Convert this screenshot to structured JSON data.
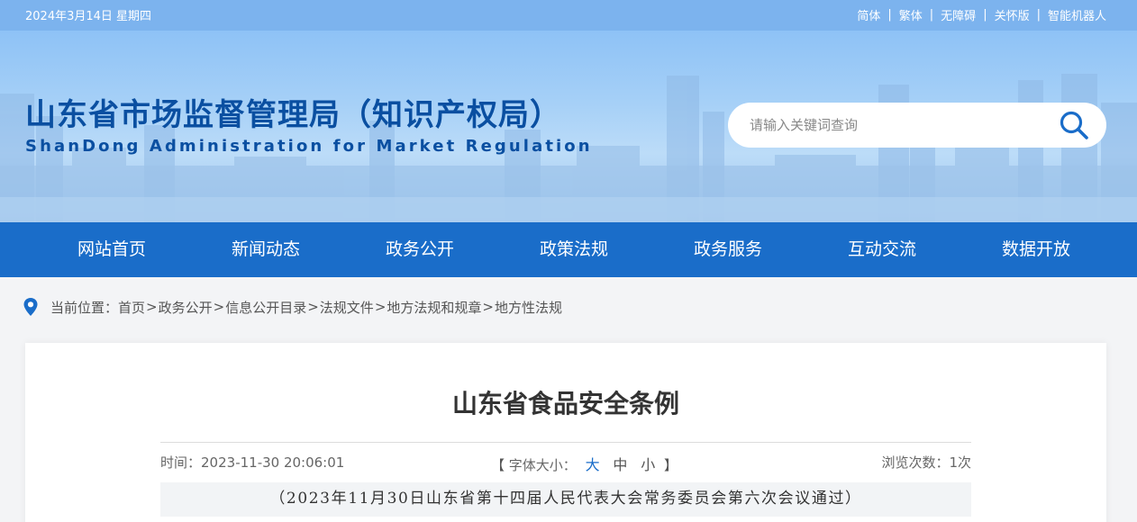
{
  "topbar": {
    "date": "2024年3月14日 星期四",
    "links": [
      "简体",
      "繁体",
      "无障碍",
      "关怀版",
      "智能机器人"
    ]
  },
  "header": {
    "title_cn": "山东省市场监督管理局（知识产权局）",
    "title_en": "ShanDong Administration for Market Regulation",
    "search_placeholder": "请输入关键词查询",
    "search_icon": "search-icon"
  },
  "nav": {
    "items": [
      "网站首页",
      "新闻动态",
      "政务公开",
      "政策法规",
      "政务服务",
      "互动交流",
      "数据开放"
    ]
  },
  "breadcrumb": {
    "icon": "location-pin-icon",
    "prefix": "当前位置：",
    "items": [
      "首页",
      "政务公开",
      "信息公开目录",
      "法规文件",
      "地方法规和规章",
      "地方性法规"
    ],
    "separator": ">"
  },
  "article": {
    "title": "山东省食品安全条例",
    "time_label": "时间：",
    "time_value": "2023-11-30 20:06:01",
    "font_label": "字体大小：",
    "font_sizes": [
      "大",
      "中",
      "小"
    ],
    "font_open": "【",
    "font_close": "】",
    "views_label": "浏览次数：",
    "views_value": "1次",
    "subtitle": "（2023年11月30日山东省第十四届人民代表大会常务委员会第六次会议通过）"
  },
  "colors": {
    "topbar": "#7cb3ee",
    "nav": "#1a6dc9",
    "title": "#0a4fa1",
    "accent": "#1a6dc9"
  }
}
